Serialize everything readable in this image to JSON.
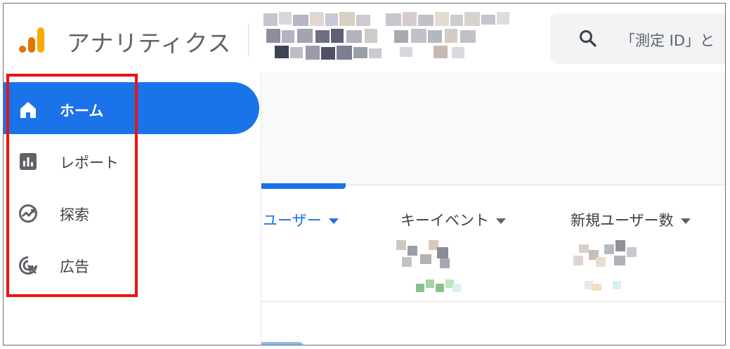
{
  "header": {
    "app_title": "アナリティクス",
    "search_placeholder": "「測定 ID」と"
  },
  "sidebar": {
    "items": [
      {
        "label": "ホーム",
        "icon": "home-icon",
        "active": true
      },
      {
        "label": "レポート",
        "icon": "bar-chart-icon",
        "active": false
      },
      {
        "label": "探索",
        "icon": "explore-icon",
        "active": false
      },
      {
        "label": "広告",
        "icon": "ads-cursor-icon",
        "active": false
      }
    ]
  },
  "main": {
    "metrics": [
      {
        "label": "ユーザー"
      },
      {
        "label": "キーイベント"
      },
      {
        "label": "新規ユーザー数"
      }
    ]
  },
  "colors": {
    "accent": "#1a73e8",
    "logo_orange": "#f9ab00",
    "logo_dark_orange": "#e37400",
    "highlight_red": "#ee1111"
  }
}
